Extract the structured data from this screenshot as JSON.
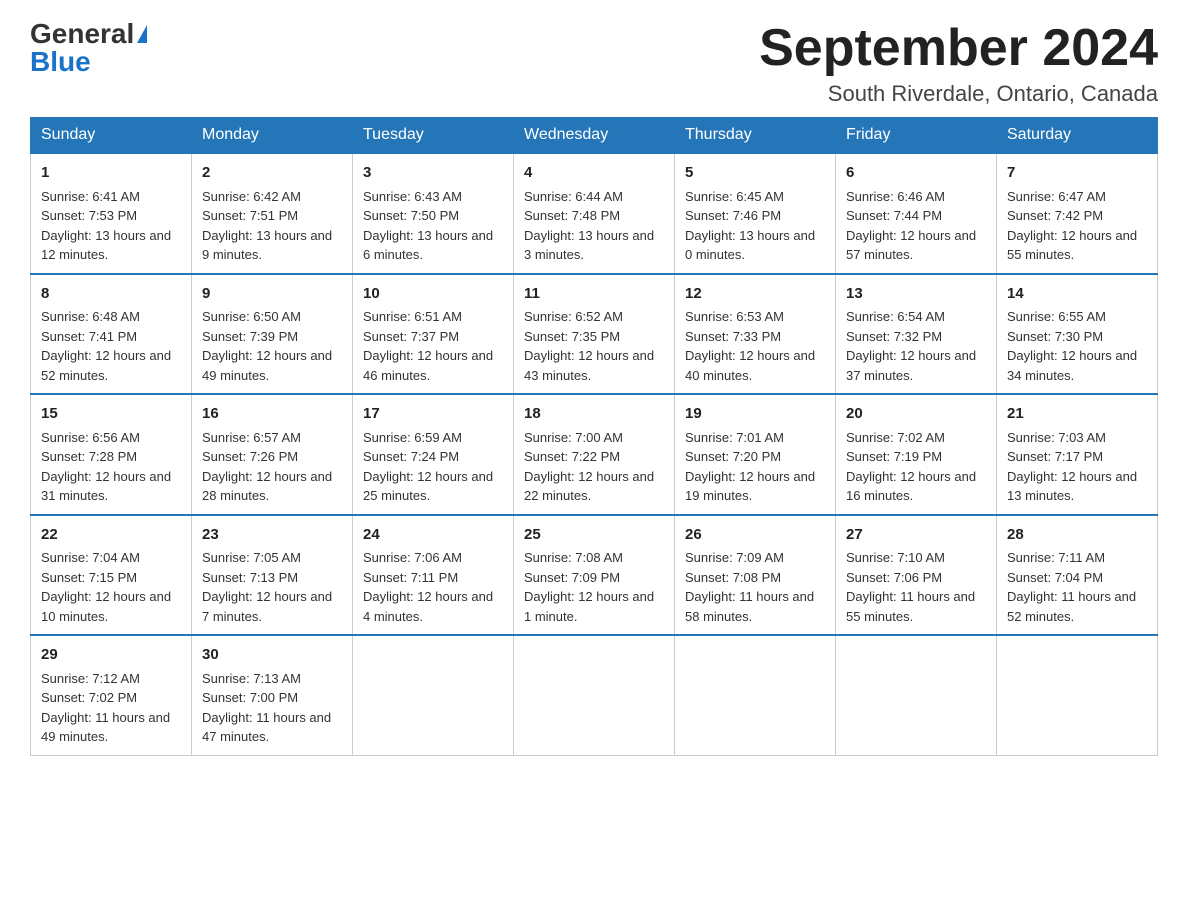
{
  "header": {
    "logo_general": "General",
    "logo_blue": "Blue",
    "title": "September 2024",
    "subtitle": "South Riverdale, Ontario, Canada"
  },
  "weekdays": [
    "Sunday",
    "Monday",
    "Tuesday",
    "Wednesday",
    "Thursday",
    "Friday",
    "Saturday"
  ],
  "weeks": [
    [
      {
        "day": "1",
        "sunrise": "Sunrise: 6:41 AM",
        "sunset": "Sunset: 7:53 PM",
        "daylight": "Daylight: 13 hours and 12 minutes."
      },
      {
        "day": "2",
        "sunrise": "Sunrise: 6:42 AM",
        "sunset": "Sunset: 7:51 PM",
        "daylight": "Daylight: 13 hours and 9 minutes."
      },
      {
        "day": "3",
        "sunrise": "Sunrise: 6:43 AM",
        "sunset": "Sunset: 7:50 PM",
        "daylight": "Daylight: 13 hours and 6 minutes."
      },
      {
        "day": "4",
        "sunrise": "Sunrise: 6:44 AM",
        "sunset": "Sunset: 7:48 PM",
        "daylight": "Daylight: 13 hours and 3 minutes."
      },
      {
        "day": "5",
        "sunrise": "Sunrise: 6:45 AM",
        "sunset": "Sunset: 7:46 PM",
        "daylight": "Daylight: 13 hours and 0 minutes."
      },
      {
        "day": "6",
        "sunrise": "Sunrise: 6:46 AM",
        "sunset": "Sunset: 7:44 PM",
        "daylight": "Daylight: 12 hours and 57 minutes."
      },
      {
        "day": "7",
        "sunrise": "Sunrise: 6:47 AM",
        "sunset": "Sunset: 7:42 PM",
        "daylight": "Daylight: 12 hours and 55 minutes."
      }
    ],
    [
      {
        "day": "8",
        "sunrise": "Sunrise: 6:48 AM",
        "sunset": "Sunset: 7:41 PM",
        "daylight": "Daylight: 12 hours and 52 minutes."
      },
      {
        "day": "9",
        "sunrise": "Sunrise: 6:50 AM",
        "sunset": "Sunset: 7:39 PM",
        "daylight": "Daylight: 12 hours and 49 minutes."
      },
      {
        "day": "10",
        "sunrise": "Sunrise: 6:51 AM",
        "sunset": "Sunset: 7:37 PM",
        "daylight": "Daylight: 12 hours and 46 minutes."
      },
      {
        "day": "11",
        "sunrise": "Sunrise: 6:52 AM",
        "sunset": "Sunset: 7:35 PM",
        "daylight": "Daylight: 12 hours and 43 minutes."
      },
      {
        "day": "12",
        "sunrise": "Sunrise: 6:53 AM",
        "sunset": "Sunset: 7:33 PM",
        "daylight": "Daylight: 12 hours and 40 minutes."
      },
      {
        "day": "13",
        "sunrise": "Sunrise: 6:54 AM",
        "sunset": "Sunset: 7:32 PM",
        "daylight": "Daylight: 12 hours and 37 minutes."
      },
      {
        "day": "14",
        "sunrise": "Sunrise: 6:55 AM",
        "sunset": "Sunset: 7:30 PM",
        "daylight": "Daylight: 12 hours and 34 minutes."
      }
    ],
    [
      {
        "day": "15",
        "sunrise": "Sunrise: 6:56 AM",
        "sunset": "Sunset: 7:28 PM",
        "daylight": "Daylight: 12 hours and 31 minutes."
      },
      {
        "day": "16",
        "sunrise": "Sunrise: 6:57 AM",
        "sunset": "Sunset: 7:26 PM",
        "daylight": "Daylight: 12 hours and 28 minutes."
      },
      {
        "day": "17",
        "sunrise": "Sunrise: 6:59 AM",
        "sunset": "Sunset: 7:24 PM",
        "daylight": "Daylight: 12 hours and 25 minutes."
      },
      {
        "day": "18",
        "sunrise": "Sunrise: 7:00 AM",
        "sunset": "Sunset: 7:22 PM",
        "daylight": "Daylight: 12 hours and 22 minutes."
      },
      {
        "day": "19",
        "sunrise": "Sunrise: 7:01 AM",
        "sunset": "Sunset: 7:20 PM",
        "daylight": "Daylight: 12 hours and 19 minutes."
      },
      {
        "day": "20",
        "sunrise": "Sunrise: 7:02 AM",
        "sunset": "Sunset: 7:19 PM",
        "daylight": "Daylight: 12 hours and 16 minutes."
      },
      {
        "day": "21",
        "sunrise": "Sunrise: 7:03 AM",
        "sunset": "Sunset: 7:17 PM",
        "daylight": "Daylight: 12 hours and 13 minutes."
      }
    ],
    [
      {
        "day": "22",
        "sunrise": "Sunrise: 7:04 AM",
        "sunset": "Sunset: 7:15 PM",
        "daylight": "Daylight: 12 hours and 10 minutes."
      },
      {
        "day": "23",
        "sunrise": "Sunrise: 7:05 AM",
        "sunset": "Sunset: 7:13 PM",
        "daylight": "Daylight: 12 hours and 7 minutes."
      },
      {
        "day": "24",
        "sunrise": "Sunrise: 7:06 AM",
        "sunset": "Sunset: 7:11 PM",
        "daylight": "Daylight: 12 hours and 4 minutes."
      },
      {
        "day": "25",
        "sunrise": "Sunrise: 7:08 AM",
        "sunset": "Sunset: 7:09 PM",
        "daylight": "Daylight: 12 hours and 1 minute."
      },
      {
        "day": "26",
        "sunrise": "Sunrise: 7:09 AM",
        "sunset": "Sunset: 7:08 PM",
        "daylight": "Daylight: 11 hours and 58 minutes."
      },
      {
        "day": "27",
        "sunrise": "Sunrise: 7:10 AM",
        "sunset": "Sunset: 7:06 PM",
        "daylight": "Daylight: 11 hours and 55 minutes."
      },
      {
        "day": "28",
        "sunrise": "Sunrise: 7:11 AM",
        "sunset": "Sunset: 7:04 PM",
        "daylight": "Daylight: 11 hours and 52 minutes."
      }
    ],
    [
      {
        "day": "29",
        "sunrise": "Sunrise: 7:12 AM",
        "sunset": "Sunset: 7:02 PM",
        "daylight": "Daylight: 11 hours and 49 minutes."
      },
      {
        "day": "30",
        "sunrise": "Sunrise: 7:13 AM",
        "sunset": "Sunset: 7:00 PM",
        "daylight": "Daylight: 11 hours and 47 minutes."
      },
      null,
      null,
      null,
      null,
      null
    ]
  ]
}
